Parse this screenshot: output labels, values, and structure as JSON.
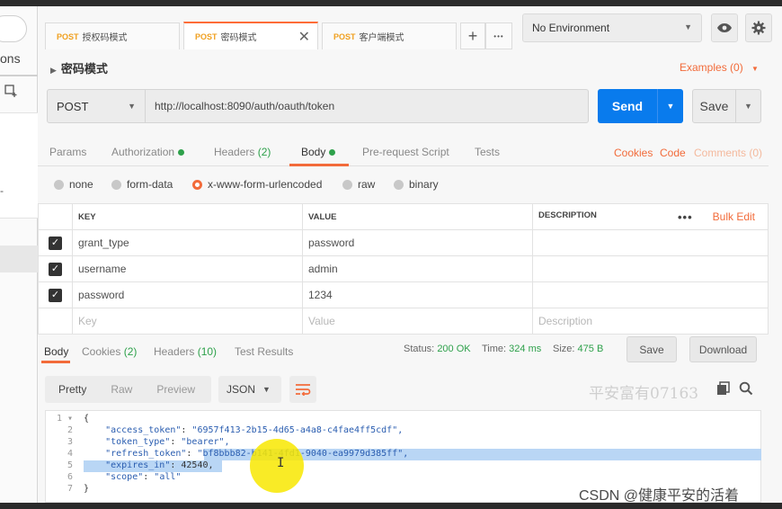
{
  "sidebar": {
    "tab_partial": "ons"
  },
  "tabs": [
    {
      "method": "POST",
      "name": "授权码模式"
    },
    {
      "method": "POST",
      "name": "密码模式",
      "active": true
    },
    {
      "method": "POST",
      "name": "客户端模式"
    }
  ],
  "tab_actions": {
    "add": "+",
    "more": "•••",
    "close": "✕"
  },
  "environment": {
    "selected": "No Environment"
  },
  "request": {
    "title": "密码模式",
    "examples": "Examples (0)",
    "method": "POST",
    "url": "http://localhost:8090/auth/oauth/token",
    "send_label": "Send",
    "save_label": "Save"
  },
  "request_tabs": {
    "params": "Params",
    "authorization": "Authorization",
    "headers": "Headers",
    "headers_count": "(2)",
    "body": "Body",
    "prerequest": "Pre-request Script",
    "tests": "Tests",
    "cookies": "Cookies",
    "code": "Code",
    "comments": "Comments (0)"
  },
  "body_types": {
    "none": "none",
    "form_data": "form-data",
    "urlencoded": "x-www-form-urlencoded",
    "raw": "raw",
    "binary": "binary",
    "selected": "x-www-form-urlencoded"
  },
  "params_table": {
    "headers": {
      "key": "KEY",
      "value": "VALUE",
      "description": "DESCRIPTION",
      "bulk": "Bulk Edit",
      "more": "•••"
    },
    "rows": [
      {
        "checked": true,
        "key": "grant_type",
        "value": "password",
        "description": ""
      },
      {
        "checked": true,
        "key": "username",
        "value": "admin",
        "description": ""
      },
      {
        "checked": true,
        "key": "password",
        "value": "1234",
        "description": ""
      }
    ],
    "placeholder": {
      "key": "Key",
      "value": "Value",
      "description": "Description"
    }
  },
  "response": {
    "tabs": {
      "body": "Body",
      "cookies": "Cookies",
      "cookies_count": "(2)",
      "headers": "Headers",
      "headers_count": "(10)",
      "tests": "Test Results"
    },
    "status_label": "Status:",
    "status": "200 OK",
    "time_label": "Time:",
    "time": "324 ms",
    "size_label": "Size:",
    "size": "475 B",
    "save_label": "Save",
    "download_label": "Download",
    "view_modes": {
      "pretty": "Pretty",
      "raw": "Raw",
      "preview": "Preview"
    },
    "format": "JSON",
    "watermark": "平安富有07163",
    "code_lines": [
      {
        "n": "1 ▾",
        "text": "{"
      },
      {
        "n": "2",
        "key": "\"access_token\"",
        "val": "\"6957f413-2b15-4d65-a4a8-c4fae4ff5cdf\","
      },
      {
        "n": "3",
        "key": "\"token_type\"",
        "val": "\"bearer\","
      },
      {
        "n": "4",
        "key": "\"refresh_token\"",
        "val": "\"bf8bbb82-b141-4fd1-9040-ea9979d385ff\","
      },
      {
        "n": "5",
        "key": "\"expires_in\"",
        "val": "42540,"
      },
      {
        "n": "6",
        "key": "\"scope\"",
        "val": "\"all\""
      },
      {
        "n": "7",
        "text": "}"
      }
    ]
  },
  "csdn_watermark": "CSDN @健康平安的活着"
}
